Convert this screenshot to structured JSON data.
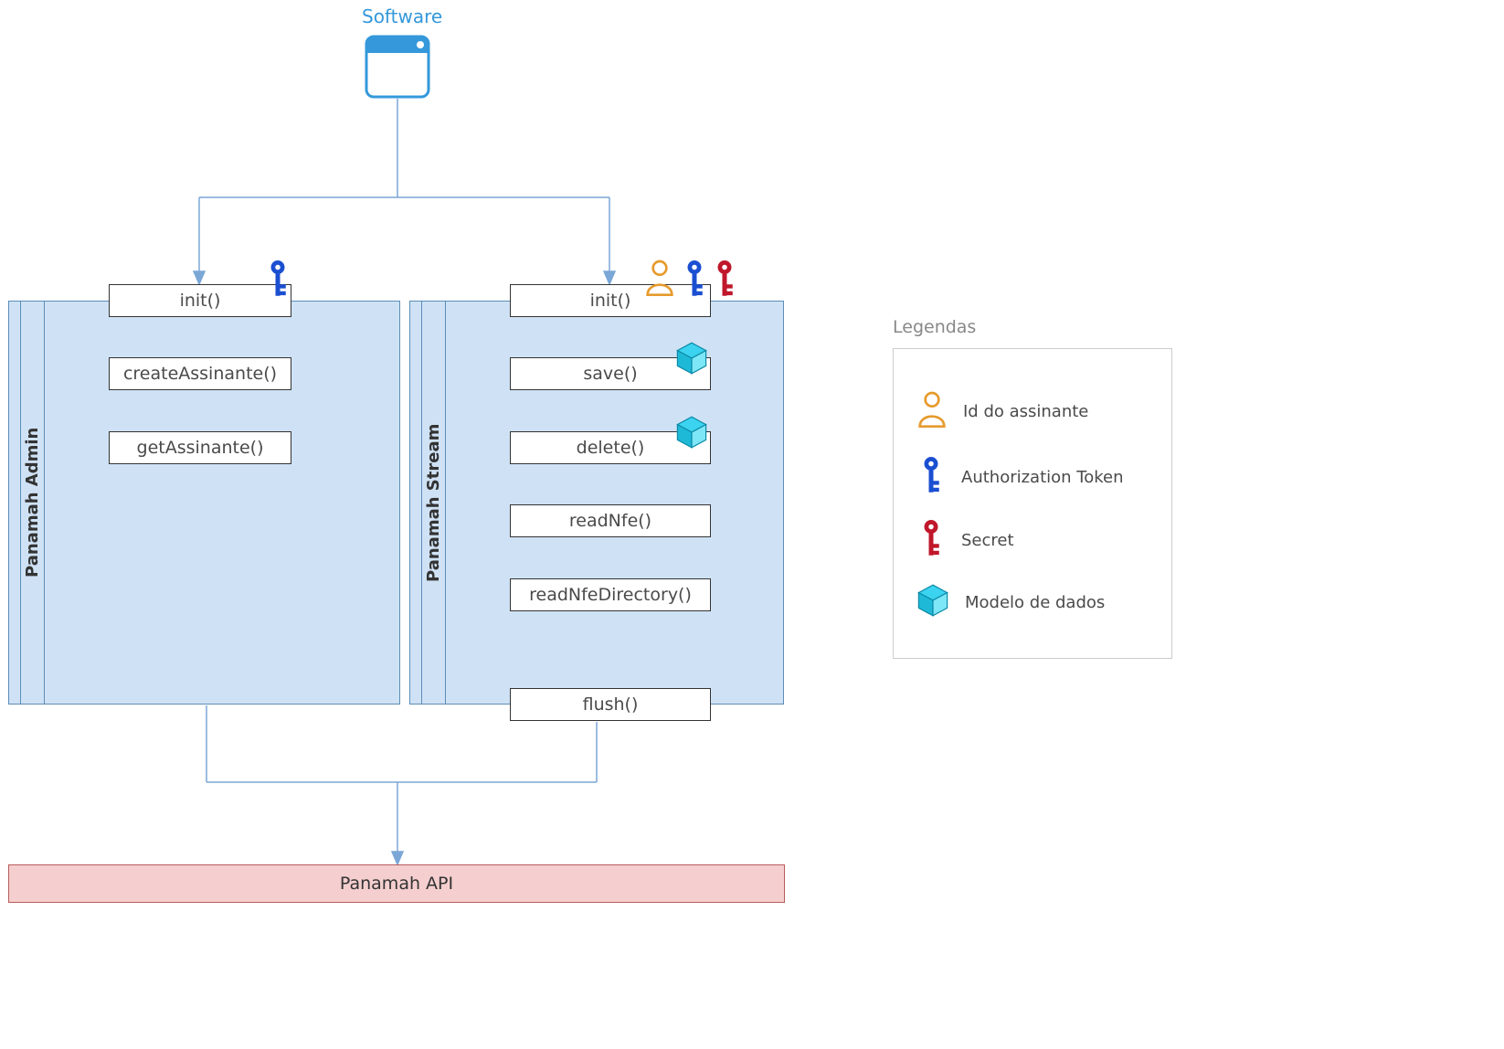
{
  "software_label": "Software",
  "panels": {
    "admin": {
      "title": "Panamah Admin",
      "methods": [
        "init()",
        "createAssinante()",
        "getAssinante()"
      ]
    },
    "stream": {
      "title": "Panamah Stream",
      "methods": [
        "init()",
        "save()",
        "delete()",
        "readNfe()",
        "readNfeDirectory()",
        "flush()"
      ]
    }
  },
  "api_label": "Panamah API",
  "legend": {
    "title": "Legendas",
    "items": [
      {
        "label": "Id do assinante"
      },
      {
        "label": "Authorization Token"
      },
      {
        "label": "Secret"
      },
      {
        "label": "Modelo de dados"
      }
    ]
  }
}
